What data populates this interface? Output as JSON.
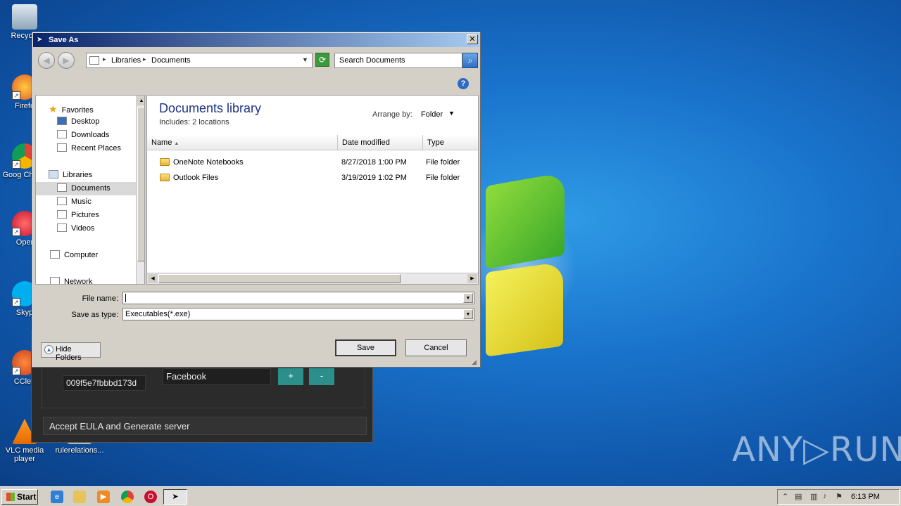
{
  "desktop": {
    "icons": [
      {
        "label": "Recycle",
        "icon": "recycle-bin-icon"
      },
      {
        "label": "Firefo",
        "icon": "firefox-icon"
      },
      {
        "label": "Goog Chrom",
        "icon": "chrome-icon"
      },
      {
        "label": "Oper",
        "icon": "opera-icon"
      },
      {
        "label": "Skyp",
        "icon": "skype-icon"
      },
      {
        "label": "CClea",
        "icon": "ccleaner-icon"
      },
      {
        "label": "VLC media player",
        "icon": "vlc-icon"
      },
      {
        "label": "rulerelations...",
        "icon": "document-icon"
      }
    ],
    "watermark": "ANY▷RUN"
  },
  "background_app": {
    "code_value": "009f5e7fbbbd173d",
    "site_value": "Facebook",
    "plus_label": "+",
    "minus_label": "-",
    "eula_label": "Accept EULA and Generate server"
  },
  "dialog": {
    "title": "Save As",
    "close_label": "✕",
    "breadcrumb": [
      "Libraries",
      "Documents"
    ],
    "search_placeholder": "Search Documents",
    "help_label": "?",
    "nav": {
      "favorites": "Favorites",
      "desktop": "Desktop",
      "downloads": "Downloads",
      "recent_places": "Recent Places",
      "libraries": "Libraries",
      "documents": "Documents",
      "music": "Music",
      "pictures": "Pictures",
      "videos": "Videos",
      "computer": "Computer",
      "network": "Network"
    },
    "library_title": "Documents library",
    "library_includes_label": "Includes:",
    "library_includes_value": "2 locations",
    "arrange_by_label": "Arrange by:",
    "arrange_by_value": "Folder",
    "columns": {
      "name": "Name",
      "date": "Date modified",
      "type": "Type"
    },
    "files": [
      {
        "name": "OneNote Notebooks",
        "date": "8/27/2018 1:00 PM",
        "type": "File folder"
      },
      {
        "name": "Outlook Files",
        "date": "3/19/2019 1:02 PM",
        "type": "File folder"
      }
    ],
    "file_name_label": "File name:",
    "file_name_value": "",
    "save_as_type_label": "Save as type:",
    "save_as_type_value": "Executables(*.exe)",
    "hide_folders_label": "Hide Folders",
    "save_label": "Save",
    "cancel_label": "Cancel"
  },
  "taskbar": {
    "start_label": "Start",
    "clock": "6:13 PM"
  }
}
